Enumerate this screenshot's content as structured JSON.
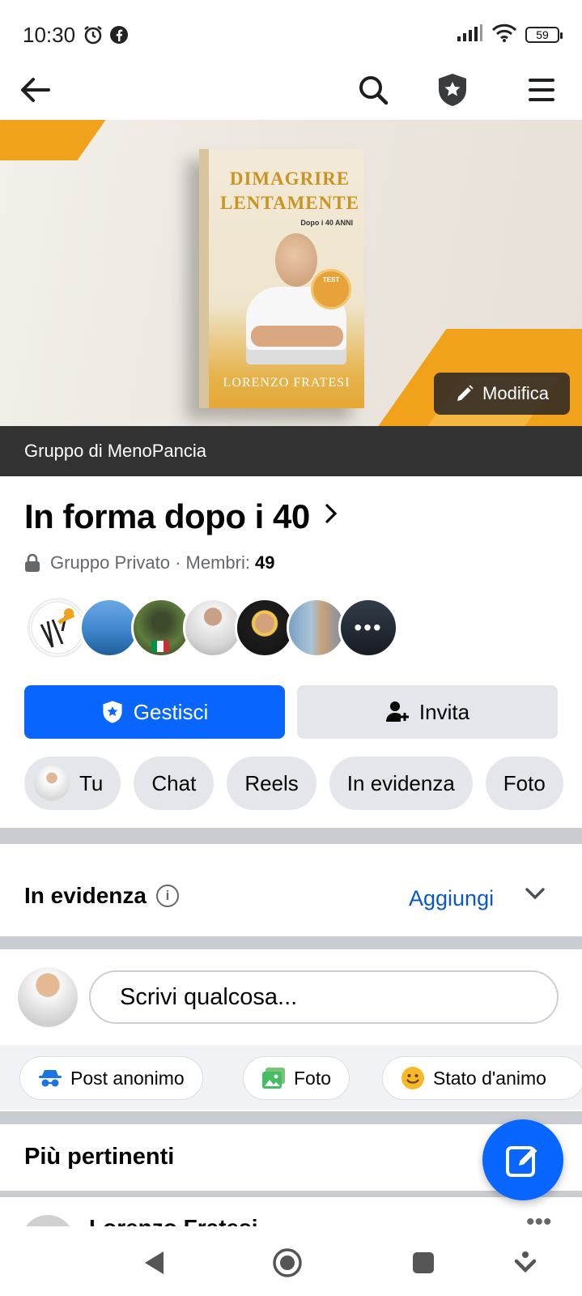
{
  "status_bar": {
    "time": "10:30",
    "icons": [
      "alarm-icon",
      "facebook-icon",
      "signal-icon",
      "wifi-icon"
    ],
    "battery": "59"
  },
  "top_nav": {
    "icons": [
      "back-arrow-icon",
      "search-icon",
      "admin-shield-icon",
      "menu-icon"
    ]
  },
  "cover": {
    "book_title": "DIMAGRIRE LENTAMENTE",
    "book_subtitle": "Dopo i 40 ANNI",
    "book_badge": "TEST",
    "book_author": "LORENZO FRATESI",
    "edit_label": "Modifica"
  },
  "group": {
    "owner_label": "Gruppo di MenoPancia",
    "name": "In forma dopo i 40",
    "privacy": "Gruppo Privato · Membri:",
    "member_count": "49"
  },
  "buttons": {
    "manage": "Gestisci",
    "invite": "Invita"
  },
  "chips": [
    {
      "label": "Tu"
    },
    {
      "label": "Chat"
    },
    {
      "label": "Reels"
    },
    {
      "label": "In evidenza"
    },
    {
      "label": "Foto"
    }
  ],
  "featured": {
    "title": "In evidenza",
    "add_label": "Aggiungi"
  },
  "composer": {
    "placeholder": "Scrivi qualcosa..."
  },
  "post_actions": [
    {
      "label": "Post anonimo",
      "icon": "anonymous-icon"
    },
    {
      "label": "Foto",
      "icon": "photo-icon"
    },
    {
      "label": "Stato d'animo",
      "icon": "smiley-icon"
    }
  ],
  "sort": {
    "label": "Più pertinenti"
  },
  "peek_post": {
    "author": "Lorenzo Fratesi"
  },
  "colors": {
    "brand_blue": "#0866ff",
    "cover_orange": "#f0a21a",
    "link_blue": "#0a58ca"
  }
}
